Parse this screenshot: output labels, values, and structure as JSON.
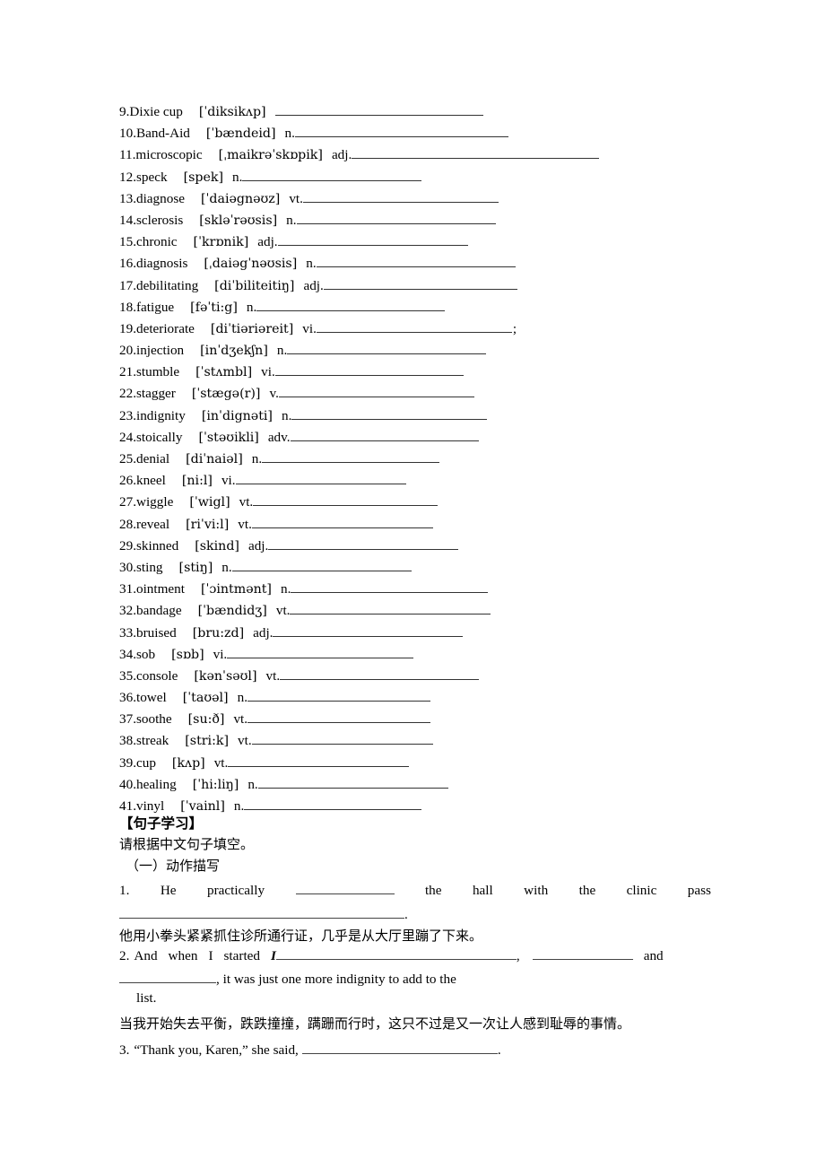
{
  "document": {
    "type": "english-vocabulary-worksheet",
    "language": "zh-CN/en"
  },
  "vocabulary": {
    "items": [
      {
        "num": "9.",
        "word": "Dixie cup",
        "ipa": "[ˈdiksikʌp]",
        "pos": "",
        "blank_width": 232,
        "tail": ""
      },
      {
        "num": "10.",
        "word": "Band-Aid",
        "ipa": "[ˈbændeid]",
        "pos": "n.",
        "blank_width": 238,
        "tail": ""
      },
      {
        "num": "11.",
        "word": "microscopic",
        "ipa": "[ˌmaikrəˈskɒpik]",
        "pos": "adj.",
        "blank_width": 276,
        "tail": ""
      },
      {
        "num": "12.",
        "word": "speck",
        "ipa": "[spek]",
        "pos": "n.",
        "blank_width": 200,
        "tail": ""
      },
      {
        "num": "13.",
        "word": "diagnose",
        "ipa": "[ˈdaiəgnəʊz]",
        "pos": "vt.",
        "blank_width": 218,
        "tail": ""
      },
      {
        "num": "14.",
        "word": "sclerosis",
        "ipa": "[skləˈrəʊsis]",
        "pos": "n.",
        "blank_width": 222,
        "tail": ""
      },
      {
        "num": "15.",
        "word": "chronic",
        "ipa": "[ˈkrɒnik]",
        "pos": "adj.",
        "blank_width": 212,
        "tail": ""
      },
      {
        "num": "16.",
        "word": "diagnosis",
        "ipa": "[ˌdaiəgˈnəʊsis]",
        "pos": "n.",
        "blank_width": 222,
        "tail": ""
      },
      {
        "num": "17.",
        "word": "debilitating",
        "ipa": "[diˈbiliteitiŋ]",
        "pos": "adj.",
        "blank_width": 216,
        "tail": ""
      },
      {
        "num": "18.",
        "word": "fatigue",
        "ipa": "[fəˈti:g]",
        "pos": "n.",
        "blank_width": 210,
        "tail": ""
      },
      {
        "num": "19.",
        "word": "deteriorate",
        "ipa": "[diˈtiəriəreit]",
        "pos": "vi.",
        "blank_width": 218,
        "tail": ";"
      },
      {
        "num": "20.",
        "word": "injection",
        "ipa": "[inˈdʒekʃn]",
        "pos": "n.",
        "blank_width": 222,
        "tail": ""
      },
      {
        "num": "21.",
        "word": "stumble",
        "ipa": "[ˈstʌmbl]",
        "pos": "vi.",
        "blank_width": 210,
        "tail": ""
      },
      {
        "num": "22.",
        "word": "stagger",
        "ipa": "[ˈstægə(r)]",
        "pos": "v.",
        "blank_width": 218,
        "tail": ""
      },
      {
        "num": "23.",
        "word": "indignity",
        "ipa": "[inˈdignəti]",
        "pos": "n.",
        "blank_width": 218,
        "tail": ""
      },
      {
        "num": "24.",
        "word": "stoically",
        "ipa": "[ˈstəʊikli]",
        "pos": "adv.",
        "blank_width": 210,
        "tail": ""
      },
      {
        "num": "25.",
        "word": "denial",
        "ipa": "[diˈnaiəl]",
        "pos": "n.",
        "blank_width": 198,
        "tail": ""
      },
      {
        "num": "26.",
        "word": "kneel",
        "ipa": "[ni:l]",
        "pos": "vi.",
        "blank_width": 190,
        "tail": ""
      },
      {
        "num": "27.",
        "word": "wiggle",
        "ipa": "[ˈwigl]",
        "pos": "vt.",
        "blank_width": 206,
        "tail": ""
      },
      {
        "num": "28.",
        "word": "reveal",
        "ipa": "[riˈvi:l]",
        "pos": "vt.",
        "blank_width": 202,
        "tail": ""
      },
      {
        "num": "29.",
        "word": "skinned",
        "ipa": "[skind]",
        "pos": "adj.",
        "blank_width": 212,
        "tail": ""
      },
      {
        "num": "30.",
        "word": "sting",
        "ipa": "[stiŋ]",
        "pos": "n.",
        "blank_width": 200,
        "tail": ""
      },
      {
        "num": "31.",
        "word": "ointment",
        "ipa": "[ˈɔintmənt]",
        "pos": "n.",
        "blank_width": 220,
        "tail": ""
      },
      {
        "num": "32.",
        "word": "bandage",
        "ipa": "[ˈbændidʒ]",
        "pos": "vt.",
        "blank_width": 224,
        "tail": ""
      },
      {
        "num": "33.",
        "word": "bruised",
        "ipa": "[bru:zd]",
        "pos": "adj.",
        "blank_width": 212,
        "tail": ""
      },
      {
        "num": "34.",
        "word": "sob",
        "ipa": "[sɒb]",
        "pos": "vi.",
        "blank_width": 208,
        "tail": ""
      },
      {
        "num": "35.",
        "word": "console",
        "ipa": "[kənˈsəʊl]",
        "pos": "vt.",
        "blank_width": 222,
        "tail": ""
      },
      {
        "num": "36.",
        "word": "towel",
        "ipa": "[ˈtaʊəl]",
        "pos": "n.",
        "blank_width": 204,
        "tail": ""
      },
      {
        "num": "37.",
        "word": "soothe",
        "ipa": "[su:ð]",
        "pos": "vt.",
        "blank_width": 204,
        "tail": ""
      },
      {
        "num": "38.",
        "word": "streak",
        "ipa": "[stri:k]",
        "pos": "vt.",
        "blank_width": 202,
        "tail": ""
      },
      {
        "num": "39.",
        "word": "cup",
        "ipa": "[kʌp]",
        "pos": "vt.",
        "blank_width": 202,
        "tail": ""
      },
      {
        "num": "40.",
        "word": "healing",
        "ipa": "[ˈhi:liŋ]",
        "pos": "n.",
        "blank_width": 212,
        "tail": ""
      },
      {
        "num": "41.",
        "word": "vinyl",
        "ipa": "[ˈvainl]",
        "pos": "n.",
        "blank_width": 198,
        "tail": ""
      }
    ]
  },
  "sentence_section": {
    "heading": "【句子学习】",
    "instruction": "请根据中文句子填空。",
    "subheading": "（一）动作描写",
    "items": [
      {
        "num": "1.",
        "line1_words": [
          "He",
          "practically"
        ],
        "blank1_width": 110,
        "line1_tail_words": [
          "the",
          "hall",
          "with",
          "the",
          "clinic",
          "pass"
        ],
        "line2_blank_width": 318,
        "line2_tail": ".",
        "translation": "他用小拳头紧紧抓住诊所通行证，几乎是从大厅里蹦了下来。"
      },
      {
        "num": "2.",
        "lead_words": [
          "And",
          "when",
          "I",
          "started"
        ],
        "italic_marker": "I",
        "blank1_width": 268,
        "comma1": ",",
        "blank2_width": 112,
        "and_word": "and",
        "line2_blank_width": 108,
        "line2_text": ", it was just one more indignity to add to the",
        "line3_text": "list.",
        "translation": "当我开始失去平衡，跌跌撞撞，蹒跚而行时，这只不过是又一次让人感到耻辱的事情。"
      },
      {
        "num": "3.",
        "text": "“Thank you, Karen,” she said,",
        "blank_width": 218,
        "tail": "."
      }
    ]
  }
}
